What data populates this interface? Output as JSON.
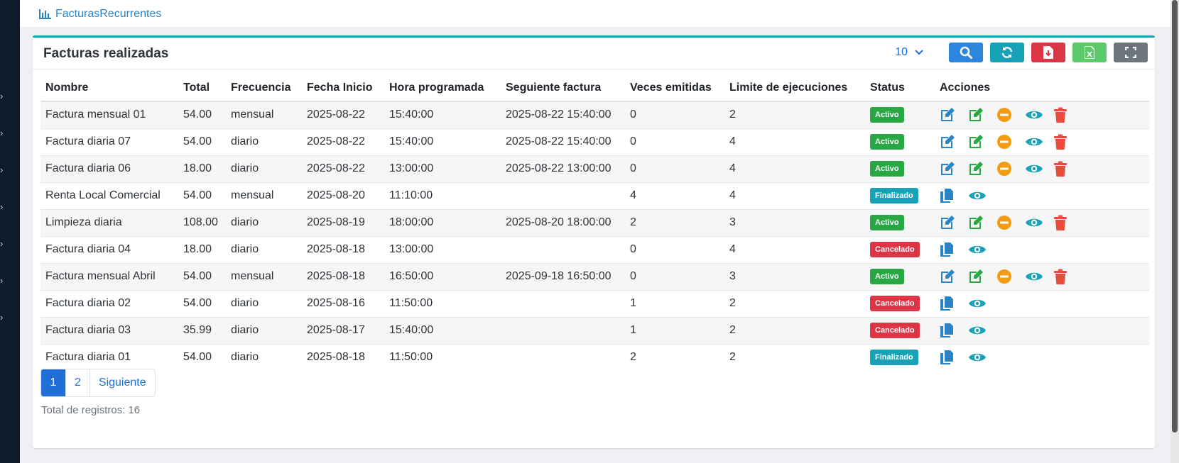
{
  "breadcrumb": {
    "label": "FacturasRecurrentes",
    "icon": "bar-chart-icon"
  },
  "card": {
    "title": "Facturas realizadas"
  },
  "toolbar": {
    "page_size": "10",
    "buttons": [
      {
        "name": "search-button",
        "icon": "search-icon",
        "color": "#2c86e0"
      },
      {
        "name": "refresh-button",
        "icon": "refresh-icon",
        "color": "#17a2b8"
      },
      {
        "name": "export-pdf-button",
        "icon": "pdf-download-icon",
        "color": "#dc3545"
      },
      {
        "name": "export-excel-button",
        "icon": "excel-icon",
        "color": "#5cc96a"
      },
      {
        "name": "fullscreen-button",
        "icon": "fullscreen-icon",
        "color": "#6c757d"
      }
    ]
  },
  "table": {
    "headers": [
      "Nombre",
      "Total",
      "Frecuencia",
      "Fecha Inicio",
      "Hora programada",
      "Seguiente factura",
      "Veces emitidas",
      "Limite de ejecuciones",
      "Status",
      "Acciones"
    ],
    "rows": [
      {
        "nombre": "Factura mensual 01",
        "total": "54.00",
        "frecuencia": "mensual",
        "fecha_inicio": "2025-08-22",
        "hora": "15:40:00",
        "siguiente": "2025-08-22 15:40:00",
        "veces": "0",
        "limite": "2",
        "status": "Activo"
      },
      {
        "nombre": "Factura diaria 07",
        "total": "54.00",
        "frecuencia": "diario",
        "fecha_inicio": "2025-08-22",
        "hora": "15:40:00",
        "siguiente": "2025-08-22 15:40:00",
        "veces": "0",
        "limite": "4",
        "status": "Activo"
      },
      {
        "nombre": "Factura diaria 06",
        "total": "18.00",
        "frecuencia": "diario",
        "fecha_inicio": "2025-08-22",
        "hora": "13:00:00",
        "siguiente": "2025-08-22 13:00:00",
        "veces": "0",
        "limite": "4",
        "status": "Activo"
      },
      {
        "nombre": "Renta Local Comercial",
        "total": "54.00",
        "frecuencia": "mensual",
        "fecha_inicio": "2025-08-20",
        "hora": "11:10:00",
        "siguiente": "",
        "veces": "4",
        "limite": "4",
        "status": "Finalizado"
      },
      {
        "nombre": "Limpieza diaria",
        "total": "108.00",
        "frecuencia": "diario",
        "fecha_inicio": "2025-08-19",
        "hora": "18:00:00",
        "siguiente": "2025-08-20 18:00:00",
        "veces": "2",
        "limite": "3",
        "status": "Activo"
      },
      {
        "nombre": "Factura diaria 04",
        "total": "18.00",
        "frecuencia": "diario",
        "fecha_inicio": "2025-08-18",
        "hora": "13:00:00",
        "siguiente": "",
        "veces": "0",
        "limite": "4",
        "status": "Cancelado"
      },
      {
        "nombre": "Factura mensual Abril",
        "total": "54.00",
        "frecuencia": "mensual",
        "fecha_inicio": "2025-08-18",
        "hora": "16:50:00",
        "siguiente": "2025-09-18 16:50:00",
        "veces": "0",
        "limite": "3",
        "status": "Activo"
      },
      {
        "nombre": "Factura diaria 02",
        "total": "54.00",
        "frecuencia": "diario",
        "fecha_inicio": "2025-08-16",
        "hora": "11:50:00",
        "siguiente": "",
        "veces": "1",
        "limite": "2",
        "status": "Cancelado"
      },
      {
        "nombre": "Factura diaria 03",
        "total": "35.99",
        "frecuencia": "diario",
        "fecha_inicio": "2025-08-17",
        "hora": "15:40:00",
        "siguiente": "",
        "veces": "1",
        "limite": "2",
        "status": "Cancelado"
      },
      {
        "nombre": "Factura diaria 01",
        "total": "54.00",
        "frecuencia": "diario",
        "fecha_inicio": "2025-08-18",
        "hora": "11:50:00",
        "siguiente": "",
        "veces": "2",
        "limite": "2",
        "status": "Finalizado"
      }
    ]
  },
  "pagination": {
    "pages": [
      "1",
      "2"
    ],
    "next_label": "Siguiente",
    "active_page": "1"
  },
  "footer": {
    "total_label": "Total de registros:",
    "total_value": "16"
  },
  "colors": {
    "accent": "#17a2b8",
    "primary": "#1f6fd6",
    "status_activo": "#28a745",
    "status_finalizado": "#17a2b8",
    "status_cancelado": "#dc3545",
    "action_edit": "#2b84c6",
    "action_edit_alt": "#28a745",
    "action_pause": "#f39c12",
    "action_view": "#17a2b8",
    "action_delete": "#e74c3c"
  }
}
